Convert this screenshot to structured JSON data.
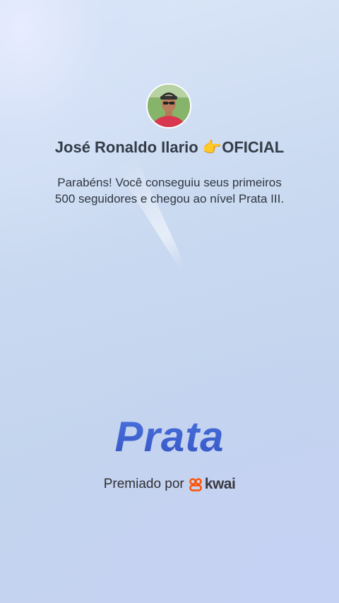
{
  "profile": {
    "name": "José Ronaldo Ilario 👉OFICIAL"
  },
  "achievement": {
    "message_line1": "Parabéns! Você conseguiu seus primeiros",
    "message_line2": "500 seguidores e chegou ao nível Prata III.",
    "level_title": "Prata"
  },
  "footer": {
    "awarded_by": "Premiado por",
    "brand_name": "kwai",
    "brand_icon": "kwai-logo-icon",
    "brand_color": "#ff5000"
  },
  "colors": {
    "level_title": "#3f62cf",
    "text": "#2e3640"
  }
}
